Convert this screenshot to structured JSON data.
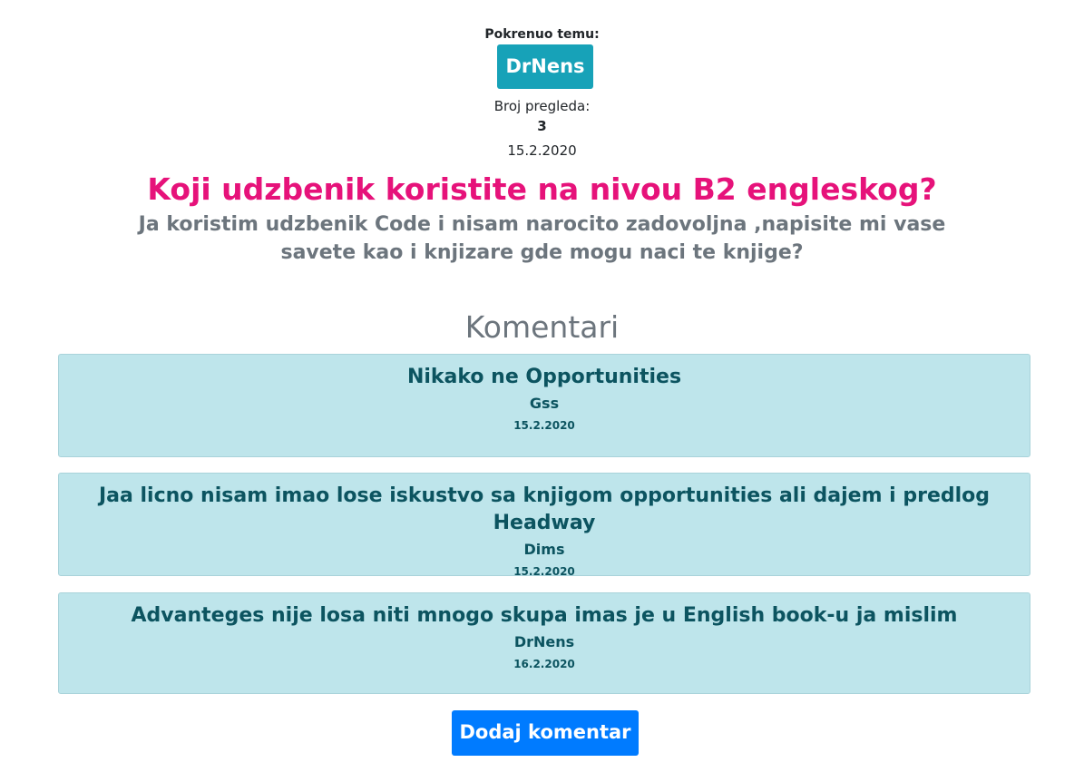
{
  "topic": {
    "starter_label": "Pokrenuo temu:",
    "author": "DrNens",
    "views_label": "Broj pregleda:",
    "views_count": "3",
    "date": "15.2.2020",
    "title": "Koji udzbenik koristite na nivou B2 engleskog?",
    "body": "Ja koristim udzbenik Code i nisam narocito zadovoljna ,napisite mi vase savete kao i knjizare gde mogu naci te knjige?"
  },
  "comments_section": {
    "heading": "Komentari",
    "items": [
      {
        "text": "Nikako ne Opportunities",
        "author": "Gss",
        "date": "15.2.2020"
      },
      {
        "text": "Jaa licno nisam imao lose iskustvo sa knjigom opportunities ali dajem i predlog Headway",
        "author": "Dims",
        "date": "15.2.2020"
      },
      {
        "text": "Advanteges nije losa niti mnogo skupa imas je u English book-u ja mislim",
        "author": "DrNens",
        "date": "16.2.2020"
      }
    ]
  },
  "actions": {
    "add_comment_label": "Dodaj komentar"
  },
  "colors": {
    "title": "#e6127a",
    "author_button": "#17a2b8",
    "add_button": "#007bff",
    "comment_bg": "#bee5eb",
    "comment_text": "#0c5460",
    "muted": "#6c757d"
  }
}
